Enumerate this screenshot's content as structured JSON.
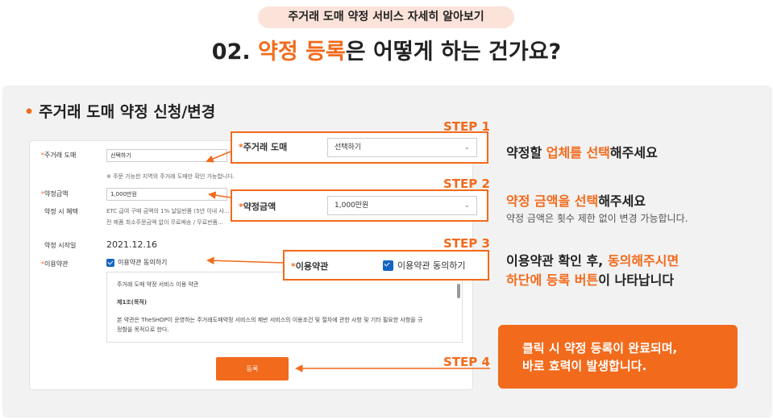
{
  "header": {
    "badge": "주거래 도매 약정 서비스 자세히 알아보기",
    "title_prefix": "02. ",
    "title_highlight": "약정 등록",
    "title_suffix": "은 어떻게 하는 건가요?"
  },
  "section_title": "주거래 도매 약정 신청/변경",
  "form": {
    "fields": [
      {
        "label": "주거래 도매",
        "required": true,
        "value": "선택하기"
      },
      {
        "label": "약정금액",
        "required": true,
        "value": "1,000만원"
      }
    ],
    "note1": "※ 주문 가능한 지역의 주거래 도매만 확인 가능합니다.",
    "benefit_label": "약정 시 혜택",
    "benefit_line1": "ETC 급여 구매 금액의 1% 날일반품 (5년 이내 사...",
    "benefit_line2": "전 제품 최소주문금액 없이 무료배송 / 무료반품...",
    "start_label": "약정 시작일",
    "start_date": "2021.12.16",
    "terms_label": "이용약관",
    "agree_label": "이용약관 동의하기",
    "terms_title": "주거래 도매 약정 서비스 이용 약관",
    "terms_article": "제1조(목적)",
    "terms_body1": "본 약관은 TheSHOP이 운영하는 주거래도매약정 서비스의 제반 서비스의 이용조건 및 절차에 관한 사항 및 기타 필요한 사항을 규",
    "terms_body2": "정함을 목적으로 한다.",
    "submit_label": "등록"
  },
  "callouts": {
    "c1_label": "주거래 도매",
    "c1_value": "선택하기",
    "c2_label": "약정금액",
    "c2_value": "1,000만원",
    "c3_label": "이용약관",
    "c3_check": "이용약관 동의하기"
  },
  "steps": {
    "s1": "STEP 1",
    "s2": "STEP 2",
    "s3": "STEP 3",
    "s4": "STEP 4"
  },
  "descriptions": {
    "d1_pre": "약정할 ",
    "d1_hl": "업체를 선택",
    "d1_post": "해주세요",
    "d2_hl": "약정 금액을 선택",
    "d2_post": "해주세요",
    "d2_sub": "약정 금액은 횟수 제한 없이 변경 가능합니다.",
    "d3_pre": "이용약관 확인 후, ",
    "d3_hl": "동의해주시면",
    "d3_hl2": "하단에 등록 버튼",
    "d3_post": "이 나타납니다",
    "d4_line1": "클릭 시 약정 등록이 완료되며,",
    "d4_line2": "바로 효력이 발생합니다."
  },
  "colors": {
    "accent": "#f26a1b",
    "badge_bg": "#fbe3d9",
    "panel_bg": "#f2f2f2",
    "checkbox": "#1565c0"
  }
}
